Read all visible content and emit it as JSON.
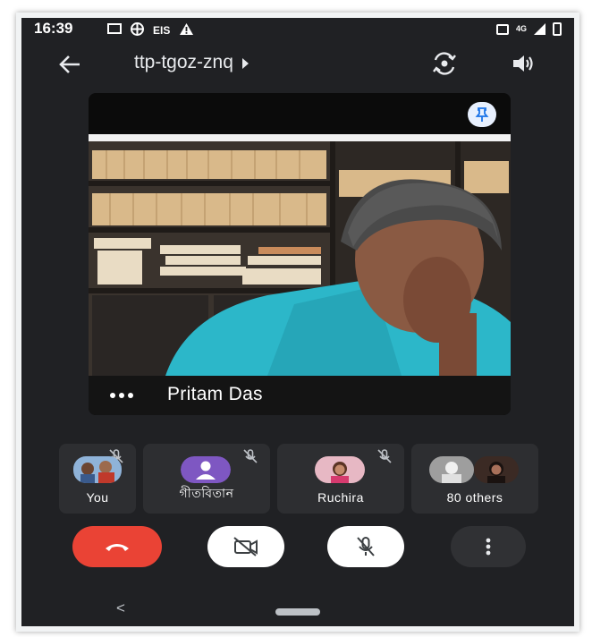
{
  "status_bar": {
    "time": "16:39",
    "left_icons": [
      "screen-cast-icon",
      "grid-icon",
      "eis-text",
      "warning-icon"
    ],
    "eis_label": "EIS",
    "signal_label": "4G",
    "right_icons": [
      "sim-icon",
      "4g-icon",
      "signal-icon",
      "battery-icon"
    ]
  },
  "toolbar": {
    "meeting_code": "ttp-tgoz-znq",
    "back_icon": "arrow-left-icon",
    "switch_camera_icon": "switch-camera-icon",
    "audio_icon": "speaker-icon"
  },
  "main_video": {
    "speaker_name": "Pritam Das",
    "pin_icon": "pin-icon",
    "more_icon": "more-horizontal-icon"
  },
  "participants": [
    {
      "label": "You",
      "muted": true,
      "avatar": "photo"
    },
    {
      "label": "গীতবিতান",
      "muted": true,
      "avatar": "default-person"
    },
    {
      "label": "Ruchira",
      "muted": true,
      "avatar": "photo"
    },
    {
      "label": "80 others",
      "muted": false,
      "avatar": "photo-stack"
    }
  ],
  "controls": {
    "end_call_icon": "phone-hangup-icon",
    "camera_icon": "video-off-icon",
    "mic_icon": "mic-off-icon",
    "more_icon": "more-vertical-icon"
  },
  "nav_bar": {
    "back_glyph": "<"
  },
  "colors": {
    "background": "#202124",
    "end_call": "#ea4335",
    "pin_bg": "#e8f0fe",
    "pin_icon": "#1a73e8",
    "default_avatar": "#7e57c2"
  }
}
